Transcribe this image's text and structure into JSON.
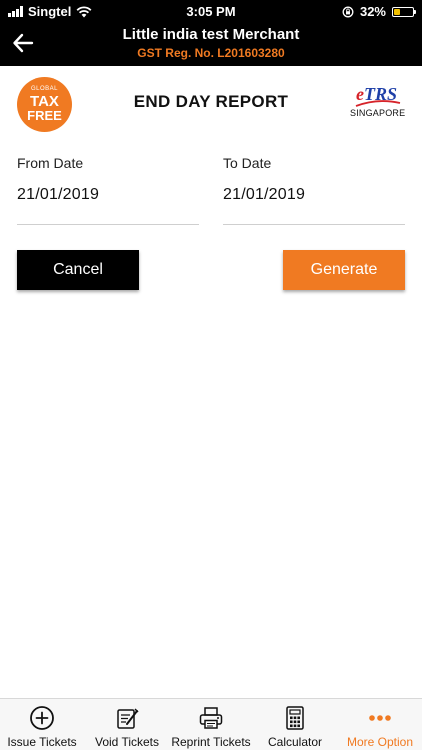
{
  "status_bar": {
    "carrier": "Singtel",
    "time": "3:05 PM",
    "battery": "32%",
    "battery_fraction": 0.32
  },
  "header": {
    "title": "Little india test Merchant",
    "subtitle": "GST Reg. No. L201603280",
    "accent_color": "#f07a22"
  },
  "brand": {
    "left_logo": {
      "line1": "GLOBAL",
      "line2": "TAX",
      "line3": "FREE"
    },
    "right_logo": {
      "mark": "TRS",
      "mark_prefix": "e",
      "country": "SINGAPORE"
    }
  },
  "page_title": "END DAY REPORT",
  "form": {
    "from_label": "From Date",
    "from_value": "21/01/2019",
    "to_label": "To Date",
    "to_value": "21/01/2019"
  },
  "actions": {
    "cancel_label": "Cancel",
    "generate_label": "Generate"
  },
  "tabs": [
    {
      "label": "Issue Tickets",
      "icon": "plus-circle-icon"
    },
    {
      "label": "Void Tickets",
      "icon": "void-ticket-icon"
    },
    {
      "label": "Reprint Tickets",
      "icon": "printer-icon"
    },
    {
      "label": "Calculator",
      "icon": "calculator-icon"
    },
    {
      "label": "More Option",
      "icon": "more-dots-icon",
      "active": true
    }
  ]
}
